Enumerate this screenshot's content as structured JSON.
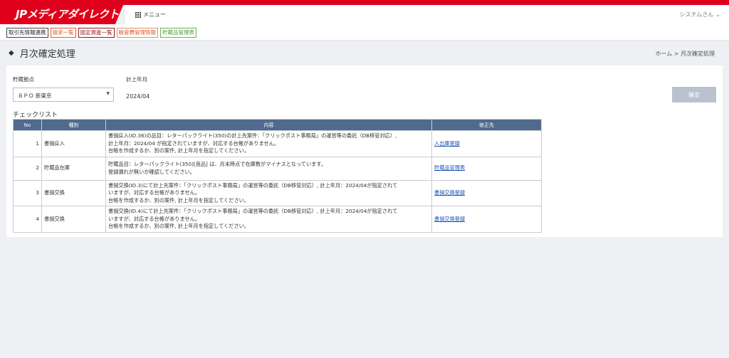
{
  "header": {
    "brand": "JPメディアダイレクト",
    "menu_label": "メニュー",
    "user_label": "システムさん"
  },
  "shortcuts": [
    "取引先情報連携",
    "請求一覧",
    "固定資産一覧",
    "販管費管理情報",
    "貯蔵品管理表"
  ],
  "page": {
    "title": "月次確定処理",
    "breadcrumb_home": "ホーム",
    "breadcrumb_sep": ">",
    "breadcrumb_current": "月次確定処理"
  },
  "form": {
    "location_label": "貯蔵拠点",
    "location_value": "ＢＰＯ 新東京",
    "month_label": "計上年月",
    "month_value": "2024/04",
    "confirm_label": "確定"
  },
  "checklist": {
    "title": "チェックリスト",
    "headers": [
      "No",
      "種別",
      "内容",
      "修正先"
    ],
    "rows": [
      {
        "no": "1",
        "type": "書損戻入",
        "lines": [
          "書損戻入(ID.36)の品目：レターパックライト(350)の計上先案件：「クリックポスト事務局」の運営等の委託（DB移管対応）,",
          "計上年月：2024/04 が指定されていますが、対応する台帳がありません。",
          "台帳を作成するか、別の案件, 計上年月を指定してください。"
        ],
        "link": "入出庫登録"
      },
      {
        "no": "2",
        "type": "貯蔵品在庫",
        "lines": [
          "貯蔵品目：レターパックライト(350)[良品] は、月末時点で在庫数がマイナスとなっています。",
          "登録漏れが無いか確認してください。"
        ],
        "link": "貯蔵品管理表"
      },
      {
        "no": "3",
        "type": "書損交換",
        "lines": [
          "書損交換(ID.3)にて計上先案件：「クリックポスト事務局」の運営等の委託（DB移管対応）, 計上年月：2024/04が指定されて",
          "いますが、対応する台帳がありません。",
          "台帳を作成するか、別の案件, 計上年月を指定してください。"
        ],
        "link": "書損交換登録"
      },
      {
        "no": "4",
        "type": "書損交換",
        "lines": [
          "書損交換(ID.4)にて計上先案件：「クリックポスト事務局」の運営等の委託（DB移管対応）, 計上年月：2024/04が指定されて",
          "いますが、対応する台帳がありません。",
          "台帳を作成するか、別の案件, 計上年月を指定してください。"
        ],
        "link": "書損交換登録"
      }
    ]
  },
  "colors": {
    "brand_red": "#e0001b",
    "table_header": "#4f6a8d",
    "link": "#1a55b3",
    "confirm_disabled": "#b9c3cf"
  }
}
